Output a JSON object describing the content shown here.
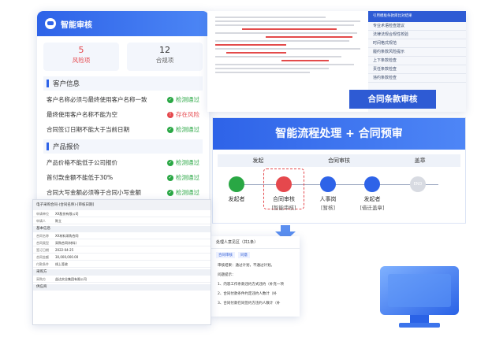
{
  "review": {
    "title": "智能审核",
    "stats": [
      {
        "value": "5",
        "label": "风险项"
      },
      {
        "value": "12",
        "label": "合规项"
      }
    ],
    "sections": [
      {
        "title": "客户信息",
        "items": [
          {
            "text": "客户名称必须与最终使用客户名称一致",
            "status": "检测通过",
            "type": "pass"
          },
          {
            "text": "最终使用客户名称不能为空",
            "status": "存在风险",
            "type": "risk"
          },
          {
            "text": "合同签订日期不能大于当前日期",
            "status": "检测通过",
            "type": "pass"
          }
        ]
      },
      {
        "title": "产品报价",
        "items": [
          {
            "text": "产品价格不能低于公司报价",
            "status": "检测通过",
            "type": "pass"
          },
          {
            "text": "首付款金额不能低于30%",
            "status": "检测通过",
            "type": "pass"
          },
          {
            "text": "合同大写金额必须等于合同小写金额",
            "status": "检测通过",
            "type": "pass"
          }
        ]
      }
    ]
  },
  "contract": {
    "banner": "合同条款审核",
    "clauses_header": "引用模板条款库比对结果",
    "clauses": [
      "专业术语检查建议",
      "法律法规合规性校验",
      "时间格式规范",
      "履约条款风险提示",
      "上下条款检查",
      "责任条款检查",
      "违约条款检查"
    ]
  },
  "flow": {
    "banner": "智能流程处理 + 合同预审",
    "columns": [
      "发起",
      "合同审核",
      "盖章"
    ],
    "nodes": [
      {
        "label": "发起者",
        "sub": ""
      },
      {
        "label": "合同审核",
        "sub": "[智能审核]"
      },
      {
        "label": "人事岗",
        "sub": "[暂核]"
      },
      {
        "label": "发起者",
        "sub": "[借迁盖章]"
      },
      {
        "label": "END",
        "sub": ""
      }
    ]
  },
  "detail": {
    "title": "处理人意见区（共1条）",
    "tabs": [
      "合同审核",
      "同意"
    ],
    "lines": [
      "审核结果：通过计划，不通过计划。",
      "问题提示：",
      "1、内容工作条款违约方式违约（补充一项",
      "2、合同付款条件约定违约人数计（补",
      "3、合同付款在同签约方违约人数计（补"
    ]
  },
  "form": {
    "title": "电子采购合同-(合同名称)-[审核日期]",
    "sections": [
      "基本信息",
      "采购方",
      "供应商"
    ],
    "rows": [
      {
        "k": "申请单位",
        "v": "XX股份有限公司"
      },
      {
        "k": "申请人",
        "v": "陈立"
      },
      {
        "k": "合同名称",
        "v": "XX材料采购合同"
      },
      {
        "k": "合同类型",
        "v": "采购合同(材料)"
      },
      {
        "k": "签订日期",
        "v": "2022-04-25"
      },
      {
        "k": "合同金额",
        "v": "30,000,000.00"
      },
      {
        "k": "付款条件",
        "v": "线上签收"
      },
      {
        "k": "采购方",
        "v": "益达实业集团有限公司"
      }
    ]
  },
  "colors": {
    "primary": "#2e63e8",
    "pass": "#29a744",
    "risk": "#e5484d"
  }
}
